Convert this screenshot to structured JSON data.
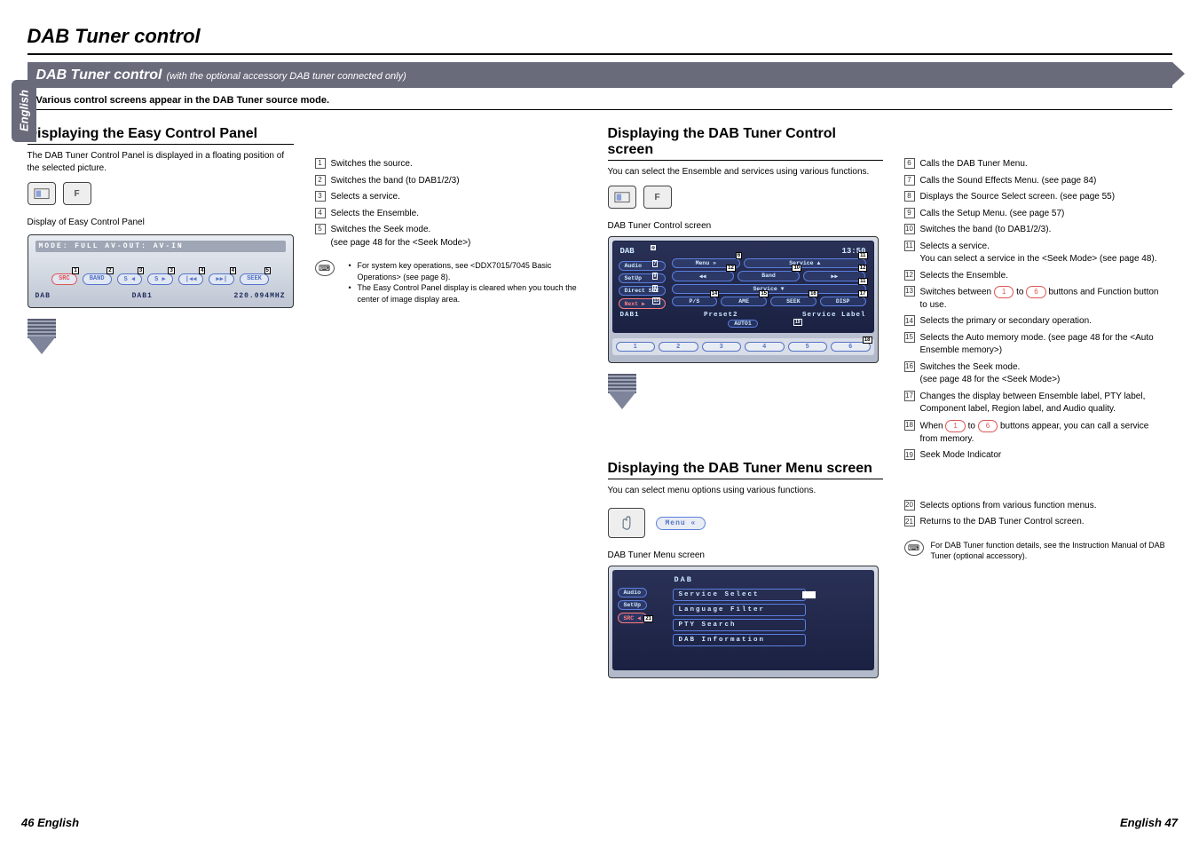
{
  "page": {
    "title": "DAB Tuner control",
    "lang_tab": "English",
    "footer_left": "46 English",
    "footer_right": "English 47"
  },
  "banner": {
    "title": "DAB Tuner control",
    "subtitle": "(with the optional accessory DAB tuner connected only)"
  },
  "subbar": "Various control screens appear in the DAB Tuner source mode.",
  "left": {
    "easy": {
      "heading": "Displaying the Easy Control Panel",
      "body": "The DAB Tuner Control Panel is displayed in a floating position of the selected picture.",
      "caption": "Display of Easy Control Panel",
      "mode_bar": "MODE: FULL  AV-OUT: AV-IN",
      "buttons": {
        "src": "SRC",
        "band": "BAND",
        "s_prev": "S ◀",
        "s_next": "S ▶",
        "seek_prev": "|◀◀",
        "seek_next": "▶▶|",
        "seek": "SEEK"
      },
      "status_left": "DAB",
      "status_mid": "DAB1",
      "status_right": "220.094MHZ"
    },
    "list": {
      "1": "Switches the source.",
      "2": "Switches the band (to DAB1/2/3)",
      "3": "Selects a service.",
      "4": "Selects the Ensemble.",
      "5a": "Switches the Seek mode.",
      "5b": "(see page 48 for the <Seek Mode>)"
    },
    "note1": "For system key operations, see <DDX7015/7045 Basic Operations> (see page 8).",
    "note2": "The Easy Control Panel display is cleared when you touch the center of image display area."
  },
  "right": {
    "ctrl": {
      "heading": "Displaying the DAB Tuner Control screen",
      "body": "You can select the Ensemble and services using various functions.",
      "caption": "DAB Tuner Control screen",
      "head_left": "DAB",
      "head_right": "13:50",
      "side": {
        "audio": "Audio",
        "setup": "SetUp",
        "direct": "Direct SRC",
        "next": "Next ▶"
      },
      "main": {
        "menu": "Menu »",
        "service_up": "Service ▲",
        "prev": "◀◀",
        "band": "Band",
        "next": "▶▶",
        "service_dn": "Service ▼",
        "ps": "P/S",
        "ame": "AME",
        "seek": "SEEK",
        "disp": "DISP"
      },
      "label_band": "DAB1",
      "label_preset": "Preset2",
      "label_service": "Service Label",
      "auto1": "AUTO1",
      "presets": [
        "1",
        "2",
        "3",
        "4",
        "5",
        "6"
      ]
    },
    "list": {
      "6": "Calls the DAB Tuner Menu.",
      "7": "Calls the Sound Effects Menu. (see page 84)",
      "8": "Displays the Source Select screen. (see page 55)",
      "9": "Calls the Setup Menu. (see page 57)",
      "10": "Switches the band (to DAB1/2/3).",
      "11a": "Selects a service.",
      "11b": "You can select a service in the <Seek Mode> (see page 48).",
      "12": "Selects the Ensemble.",
      "13a": "Switches between",
      "13b": "to",
      "13c": "buttons and Function button to use.",
      "14": "Selects the primary or secondary operation.",
      "15": "Selects the Auto memory mode. (see page 48 for the <Auto Ensemble memory>)",
      "16a": "Switches the Seek mode.",
      "16b": "(see page 48 for the <Seek Mode>)",
      "17": "Changes the display between Ensemble label, PTY label, Component label, Region label, and Audio quality.",
      "18a": "When",
      "18b": "to",
      "18c": "buttons appear, you can call a service from memory.",
      "19": "Seek Mode Indicator"
    },
    "menu": {
      "heading": "Displaying the DAB Tuner Menu screen",
      "body": "You can select menu options using various functions.",
      "caption": "DAB Tuner Menu screen",
      "head": "DAB",
      "side": {
        "audio": "Audio",
        "setup": "SetUp",
        "src": "SRC ◀"
      },
      "items": [
        "Service Select",
        "Language Filter",
        "PTY Search",
        "DAB Information"
      ],
      "menu_button": "Menu «"
    },
    "list2": {
      "20": "Selects options from various function menus.",
      "21": "Returns to the DAB Tuner Control screen."
    },
    "note3": "For DAB Tuner function details, see the Instruction Manual of DAB Tuner (optional accessory).",
    "pill1": "1",
    "pill6": "6"
  }
}
